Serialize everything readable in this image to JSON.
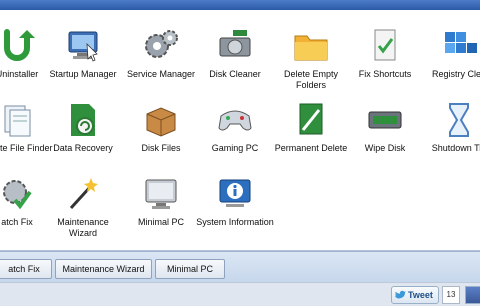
{
  "tools_row1": [
    {
      "label": "Uninstaller",
      "icon": "uninstaller-icon"
    },
    {
      "label": "Startup Manager",
      "icon": "startup-manager-icon"
    },
    {
      "label": "Service Manager",
      "icon": "service-manager-icon"
    },
    {
      "label": "Disk Cleaner",
      "icon": "disk-cleaner-icon"
    },
    {
      "label": "Delete Empty Folders",
      "icon": "folder-icon"
    },
    {
      "label": "Fix Shortcuts",
      "icon": "fix-shortcuts-icon"
    },
    {
      "label": "Registry Clea",
      "icon": "registry-cleaner-icon"
    }
  ],
  "tools_row2": [
    {
      "label": "plicate File Finder",
      "icon": "duplicate-file-finder-icon"
    },
    {
      "label": "Data Recovery",
      "icon": "data-recovery-icon"
    },
    {
      "label": "Disk Files",
      "icon": "disk-files-icon"
    },
    {
      "label": "Gaming PC",
      "icon": "gaming-pc-icon"
    },
    {
      "label": "Permanent Delete",
      "icon": "permanent-delete-icon"
    },
    {
      "label": "Wipe Disk",
      "icon": "wipe-disk-icon"
    },
    {
      "label": "Shutdown Tin",
      "icon": "shutdown-timer-icon"
    }
  ],
  "tools_row3": [
    {
      "label": "atch Fix",
      "icon": "batch-fix-icon"
    },
    {
      "label": "Maintenance Wizard",
      "icon": "maintenance-wizard-icon"
    },
    {
      "label": "Minimal PC",
      "icon": "minimal-pc-icon"
    },
    {
      "label": "System Information",
      "icon": "system-information-icon"
    }
  ],
  "quick_buttons": [
    "atch Fix",
    "Maintenance Wizard",
    "Minimal PC"
  ],
  "footer": {
    "tweet_label": "Tweet",
    "tweet_count": "13"
  }
}
